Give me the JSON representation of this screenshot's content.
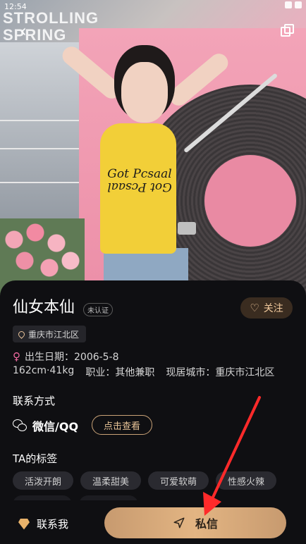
{
  "status_bar": {
    "time": "12:54"
  },
  "hero": {
    "sign_line1": "STROLLING",
    "sign_line2": "SPRING",
    "shirt_line1": "Got Pcsaal",
    "shirt_line2": "Got Pcsaal"
  },
  "profile": {
    "name": "仙女本仙",
    "verify_badge": "未认证",
    "follow_label": "关注",
    "location": "重庆市江北区",
    "birth": "出生日期：2006-5-8",
    "details": [
      "162cm·41kg",
      "职业：其他兼职",
      "现居城市：重庆市江北区"
    ]
  },
  "contact": {
    "title": "联系方式",
    "method": "微信/QQ",
    "view_button": "点击查看"
  },
  "tags": {
    "title": "TA的标签",
    "items": [
      "活泼开朗",
      "温柔甜美",
      "可爱软萌",
      "性感火辣"
    ]
  },
  "bottom": {
    "contact_me": "联系我",
    "message_button": "私信"
  },
  "colors": {
    "accent_gold": "#e3b583",
    "card_bg": "#0f0f12",
    "tag_bg": "#2a2a30",
    "annotation_arrow": "#ff2a2a"
  }
}
